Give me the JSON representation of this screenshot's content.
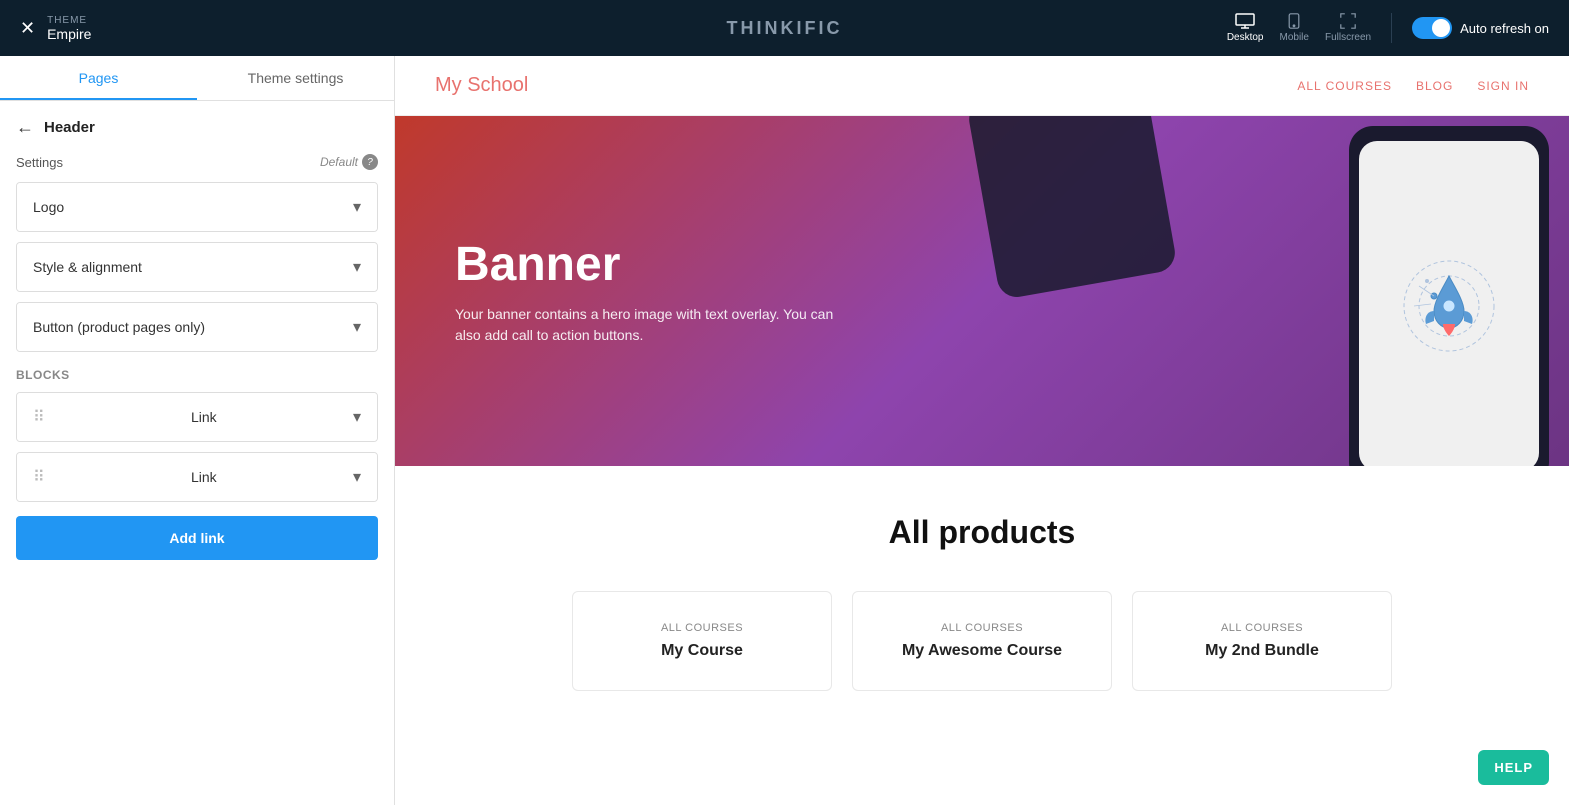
{
  "topbar": {
    "theme_label": "THEME",
    "theme_name": "Empire",
    "logo": "THINKIFIC",
    "view_options": [
      {
        "id": "desktop",
        "label": "Desktop",
        "active": true
      },
      {
        "id": "mobile",
        "label": "Mobile",
        "active": false
      },
      {
        "id": "fullscreen",
        "label": "Fullscreen",
        "active": false
      }
    ],
    "auto_refresh": "Auto refresh on"
  },
  "sidebar": {
    "tabs": [
      {
        "id": "pages",
        "label": "Pages",
        "active": true
      },
      {
        "id": "theme-settings",
        "label": "Theme settings",
        "active": false
      }
    ],
    "header_title": "Header",
    "settings_label": "Settings",
    "default_label": "Default",
    "accordion_items": [
      {
        "id": "logo",
        "label": "Logo"
      },
      {
        "id": "style-alignment",
        "label": "Style & alignment"
      },
      {
        "id": "button-product",
        "label": "Button (product pages only)"
      }
    ],
    "blocks_label": "Blocks",
    "block_items": [
      {
        "id": "link-1",
        "label": "Link"
      },
      {
        "id": "link-2",
        "label": "Link"
      }
    ],
    "add_link_label": "Add link"
  },
  "preview": {
    "nav": {
      "logo": "My School",
      "links": [
        {
          "id": "all-courses",
          "label": "ALL COURSES"
        },
        {
          "id": "blog",
          "label": "BLOG"
        },
        {
          "id": "sign-in",
          "label": "SIGN IN"
        }
      ]
    },
    "banner": {
      "title": "Banner",
      "subtitle": "Your banner contains a hero image with text overlay. You can also add call to action buttons."
    },
    "products_section": {
      "title": "All products",
      "cards": [
        {
          "id": "course-1",
          "category": "All Courses",
          "name": "My Course"
        },
        {
          "id": "course-2",
          "category": "All Courses",
          "name": "My Awesome Course"
        },
        {
          "id": "bundle-1",
          "category": "All Courses",
          "name": "My 2nd Bundle"
        }
      ]
    }
  },
  "help_button": "HELP"
}
